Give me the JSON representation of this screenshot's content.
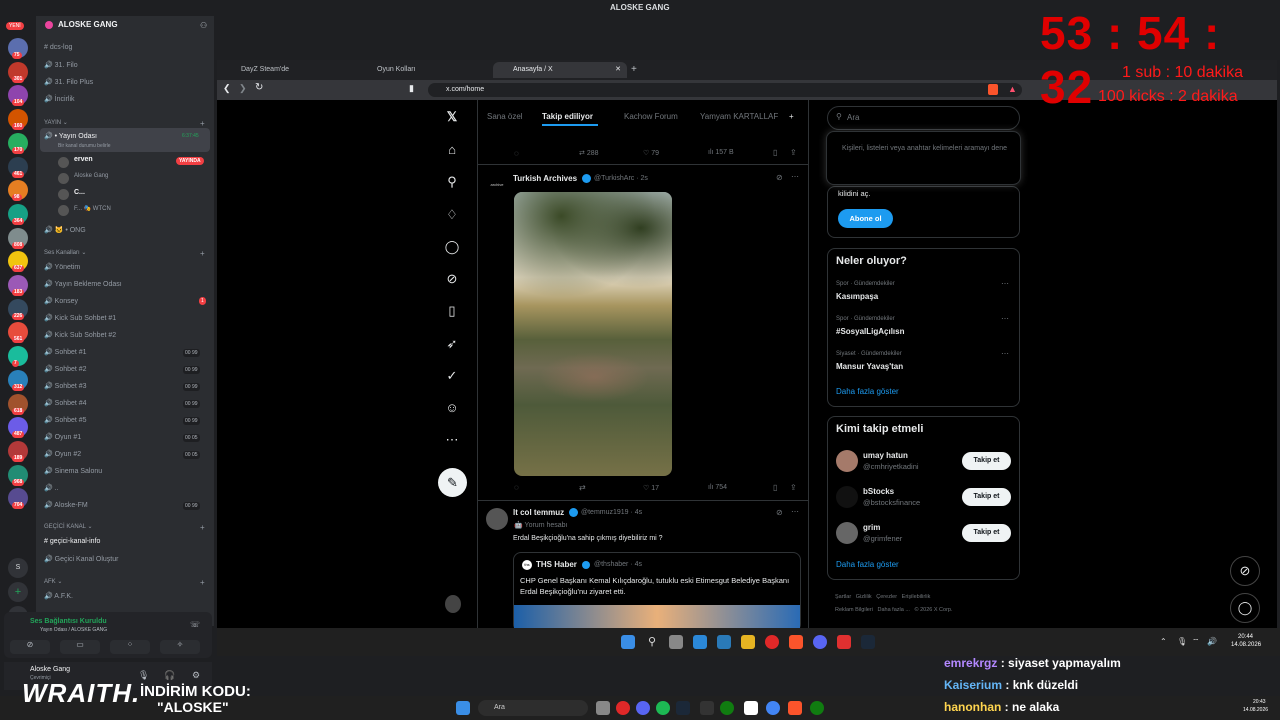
{
  "window_title": "ALOSKE GANG",
  "discord": {
    "guild_name": "ALOSKE GANG",
    "new_badge": "YENİ",
    "server_badges": [
      "75",
      "301",
      "104",
      "160",
      "170",
      "461",
      "98",
      "364",
      "808",
      "637",
      "183",
      "226",
      "561",
      "7",
      "312",
      "618",
      "487",
      "189",
      "968",
      "704"
    ],
    "channels": [
      {
        "name": "dcs-log",
        "icon": "#"
      },
      {
        "name": "31. Filo",
        "icon": "🔊"
      },
      {
        "name": "31. Filo Plus",
        "icon": "🔊"
      },
      {
        "name": "İncirlik",
        "icon": "🔊"
      }
    ],
    "category_yayin": "YAYIN",
    "live_channel": "Yayın Odası",
    "live_time": "6:37:45",
    "live_status": "Bir kanal durumu belirle",
    "voice_users": [
      "erven",
      "Aloske Gang",
      "C...",
      "F..."
    ],
    "live_badge": "YAYINDA",
    "wtcn": "WTCN",
    "ong": "ONG",
    "category_ses": "Ses Kanalları",
    "voice_channels": [
      {
        "name": "Yönetim",
        "counter": ""
      },
      {
        "name": "Yayın Bekleme Odası",
        "counter": ""
      },
      {
        "name": "Konsey",
        "counter": "1"
      },
      {
        "name": "Kick Sub Sohbet #1",
        "counter": ""
      },
      {
        "name": "Kick Sub Sohbet #2",
        "counter": ""
      },
      {
        "name": "Sohbet #1",
        "counter": "00 99"
      },
      {
        "name": "Sohbet #2",
        "counter": "00 99"
      },
      {
        "name": "Sohbet #3",
        "counter": "00 99"
      },
      {
        "name": "Sohbet #4",
        "counter": "00 99"
      },
      {
        "name": "Sohbet #5",
        "counter": "00 99"
      },
      {
        "name": "Oyun #1",
        "counter": "00 05"
      },
      {
        "name": "Oyun #2",
        "counter": "00 05"
      },
      {
        "name": "Sinema Salonu",
        "counter": ""
      },
      {
        "name": "..",
        "counter": ""
      },
      {
        "name": "Aloske-FM",
        "counter": "00 99"
      }
    ],
    "category_gecici": "GEÇİCİ KANAL",
    "gecici_channels": [
      "geçici-kanal-info",
      "Geçici Kanal Oluştur"
    ],
    "category_afk": "AFK",
    "afk_channel": "A.F.K.",
    "voice_connected": "Ses Bağlantısı Kuruldu",
    "voice_connected_sub": "Yayın Odası / ALOSKE GANG",
    "user_name": "Aloske Gang",
    "user_status": "Çevrimiçi"
  },
  "browser": {
    "tabs": [
      "DayZ Steam'de",
      "Oyun Kolları",
      "Anasayfa / X"
    ],
    "url": "x.com/home"
  },
  "x": {
    "feed_tabs": [
      "Sana özel",
      "Takip ediliyor",
      "Kachow Forum",
      "Yamyam KARTALLAF"
    ],
    "top_stats": {
      "retweets": "288",
      "likes": "79",
      "views": "157 B"
    },
    "tweet1": {
      "name": "Turkish Archives",
      "handle": "@TurkishArc · 2s",
      "replies": "",
      "likes": "17",
      "views": "754"
    },
    "tweet2": {
      "name": "lt col temmuz",
      "handle": "@temmuz1919 · 4s",
      "label": "Yorum hesabı",
      "text": "Erdal Beşikçioğlu'na sahip çıkmış diyebiliriz mi ?"
    },
    "quote": {
      "name": "THS Haber",
      "handle": "@thshaber · 4s",
      "text": "CHP Genel Başkanı Kemal Kılıçdaroğlu, tutuklu eski Etimesgut Belediye Başkanı Erdal Beşikçioğlu'nu ziyaret etti."
    },
    "search_placeholder": "Ara",
    "search_hint": "Kişileri, listeleri veya anahtar kelimeleri aramayı dene",
    "unlock_text": "kilidini aç.",
    "subscribe": "Abone ol",
    "trends_title": "Neler oluyor?",
    "trends": [
      {
        "meta": "Spor · Gündemdekiler",
        "name": "Kasımpaşa"
      },
      {
        "meta": "Spor · Gündemdekiler",
        "name": "#SosyalLigAçılısn"
      },
      {
        "meta": "Siyaset · Gündemdekiler",
        "name": "Mansur Yavaş'tan"
      }
    ],
    "show_more": "Daha fazla göster",
    "follow_title": "Kimi takip etmeli",
    "follow": [
      {
        "name": "umay hatun",
        "handle": "@cmhriyetkadini"
      },
      {
        "name": "bStocks",
        "handle": "@bstocksfinance"
      },
      {
        "name": "grim",
        "handle": "@grimfener"
      }
    ],
    "follow_button": "Takip et",
    "footer": [
      "Şartlar",
      "Gizlilik",
      "Çerezler",
      "Erişilebilirlik",
      "Reklam Bilgileri",
      "Daha fazla ...",
      "© 2026 X Corp."
    ]
  },
  "taskbar": {
    "time": "20:44",
    "date": "14.08.2026",
    "search": "Ara",
    "time2": "20:43",
    "date2": "14.08.2026"
  },
  "overlay": {
    "timer": "53 : 54 : 32",
    "sub_line": "1 sub : 10 dakika",
    "kick_line": "100 kicks : 2 dakika",
    "sponsor": "WRAITH.",
    "code_label": "İNDİRİM KODU:",
    "code": "\"ALOSKE\"",
    "chat": [
      {
        "user": "emrekrgz",
        "msg": "siyaset yapmayalım",
        "color": "#b388ff"
      },
      {
        "user": "Kaiserium",
        "msg": "knk düzeldi",
        "color": "#64b5f6"
      },
      {
        "user": "hanonhan",
        "msg": "ne alaka",
        "color": "#ffd54f"
      }
    ]
  }
}
